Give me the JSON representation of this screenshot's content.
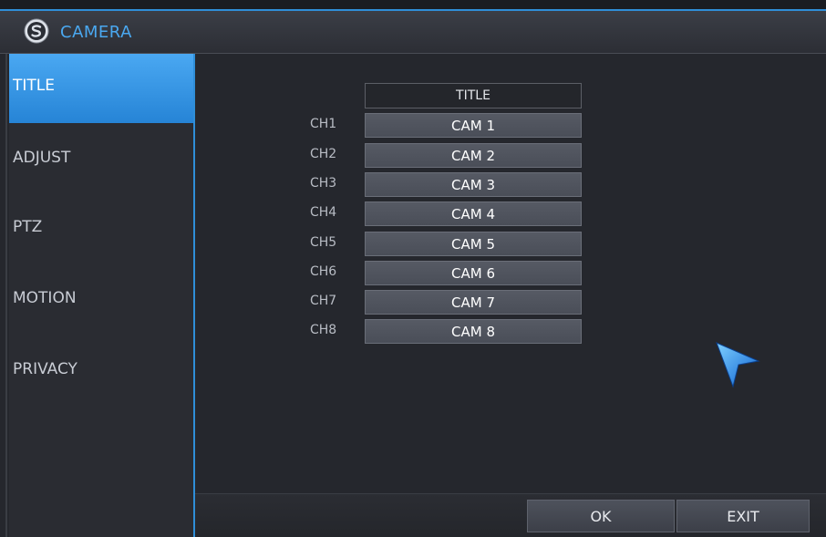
{
  "window": {
    "title": "CAMERA",
    "accent": "#2f8ed8"
  },
  "sidebar": {
    "items": [
      {
        "label": "TITLE",
        "active": true
      },
      {
        "label": "ADJUST",
        "active": false
      },
      {
        "label": "PTZ",
        "active": false
      },
      {
        "label": "MOTION",
        "active": false
      },
      {
        "label": "PRIVACY",
        "active": false
      }
    ]
  },
  "main": {
    "column_header": "TITLE",
    "channels": [
      {
        "channel": "CH1",
        "title": "CAM 1"
      },
      {
        "channel": "CH2",
        "title": "CAM 2"
      },
      {
        "channel": "CH3",
        "title": "CAM 3"
      },
      {
        "channel": "CH4",
        "title": "CAM 4"
      },
      {
        "channel": "CH5",
        "title": "CAM 5"
      },
      {
        "channel": "CH6",
        "title": "CAM 6"
      },
      {
        "channel": "CH7",
        "title": "CAM 7"
      },
      {
        "channel": "CH8",
        "title": "CAM 8"
      }
    ]
  },
  "footer": {
    "ok_label": "OK",
    "exit_label": "EXIT"
  },
  "icons": {
    "logo": "brand-logo-icon",
    "pointer": "mouse-pointer-icon"
  }
}
